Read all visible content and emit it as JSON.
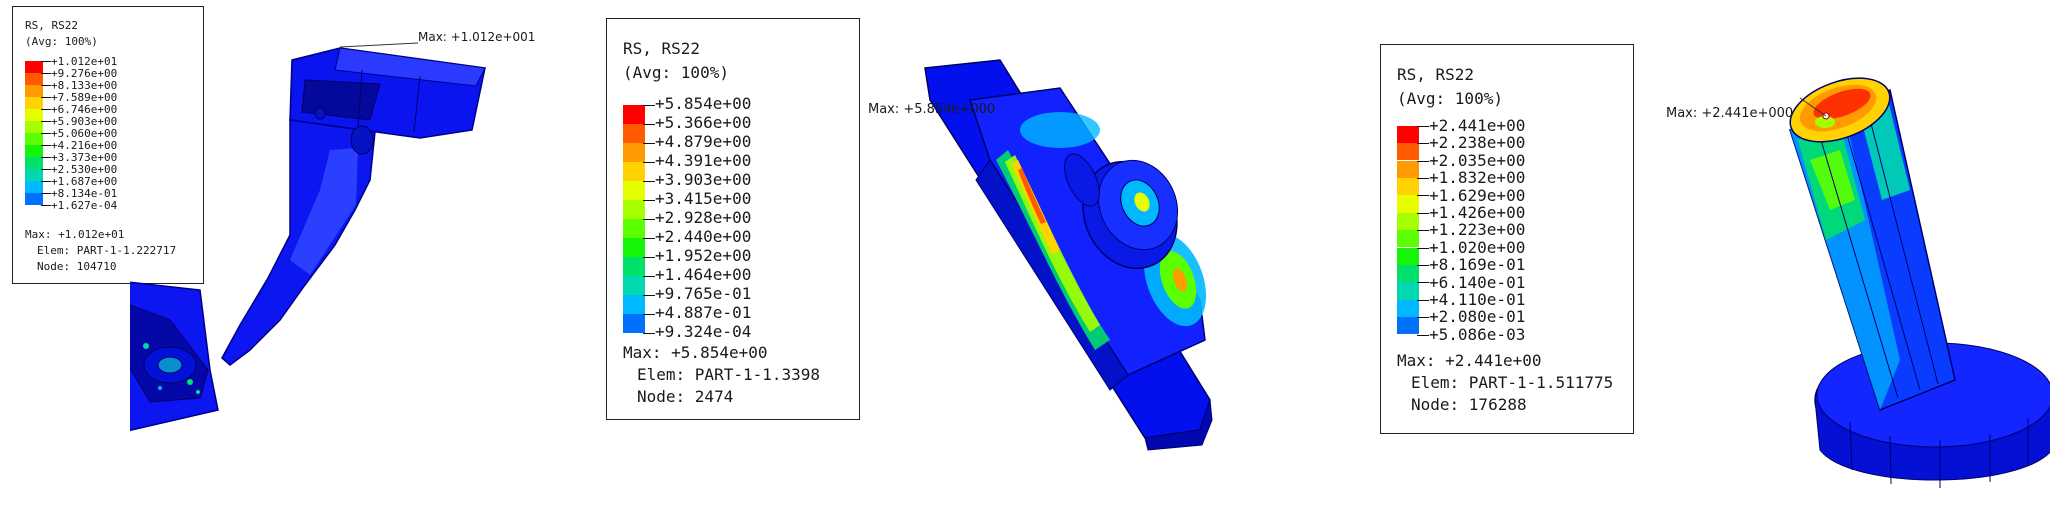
{
  "panels": [
    {
      "id": "left",
      "legend": {
        "title_line1": "RS, RS22",
        "title_line2": "(Avg: 100%)",
        "values": [
          "+1.012e+01",
          "+9.276e+00",
          "+8.133e+00",
          "+7.589e+00",
          "+6.746e+00",
          "+5.903e+00",
          "+5.060e+00",
          "+4.216e+00",
          "+3.373e+00",
          "+2.530e+00",
          "+1.687e+00",
          "+8.134e-01",
          "+1.627e-04"
        ],
        "colors": [
          "#ff0000",
          "#ff5a00",
          "#ff9b00",
          "#ffd200",
          "#e6ff00",
          "#a6ff00",
          "#5cff00",
          "#14f50a",
          "#00e06a",
          "#00d8b0",
          "#00b8ff",
          "#0070ff",
          "#0000ff"
        ],
        "max": "Max: +1.012e+01",
        "elem": "Elem: PART-1-1.222717",
        "node": "Node: 104710"
      },
      "max_tag": "Max: +1.012e+001"
    },
    {
      "id": "middle",
      "legend": {
        "title_line1": "RS, RS22",
        "title_line2": "(Avg: 100%)",
        "values": [
          "+5.854e+00",
          "+5.366e+00",
          "+4.879e+00",
          "+4.391e+00",
          "+3.903e+00",
          "+3.415e+00",
          "+2.928e+00",
          "+2.440e+00",
          "+1.952e+00",
          "+1.464e+00",
          "+9.765e-01",
          "+4.887e-01",
          "+9.324e-04"
        ],
        "colors": [
          "#ff0000",
          "#ff5a00",
          "#ff9b00",
          "#ffd200",
          "#e6ff00",
          "#a6ff00",
          "#5cff00",
          "#14f50a",
          "#00e06a",
          "#00d8b0",
          "#00b8ff",
          "#0070ff",
          "#0000ff"
        ],
        "max": "Max: +5.854e+00",
        "elem": "Elem: PART-1-1.3398",
        "node": "Node: 2474"
      },
      "max_tag": "Max: +5.854e+000"
    },
    {
      "id": "right",
      "legend": {
        "title_line1": "RS, RS22",
        "title_line2": "(Avg: 100%)",
        "values": [
          "+2.441e+00",
          "+2.238e+00",
          "+2.035e+00",
          "+1.832e+00",
          "+1.629e+00",
          "+1.426e+00",
          "+1.223e+00",
          "+1.020e+00",
          "+8.169e-01",
          "+6.140e-01",
          "+4.110e-01",
          "+2.080e-01",
          "+5.086e-03"
        ],
        "colors": [
          "#ff0000",
          "#ff5a00",
          "#ff9b00",
          "#ffd200",
          "#e6ff00",
          "#a6ff00",
          "#5cff00",
          "#14f50a",
          "#00e06a",
          "#00d8b0",
          "#00b8ff",
          "#0070ff",
          "#0000ff"
        ],
        "max": "Max: +2.441e+00",
        "elem": "Elem: PART-1-1.511775",
        "node": "Node: 176288"
      },
      "max_tag": "Max: +2.441e+000"
    }
  ]
}
